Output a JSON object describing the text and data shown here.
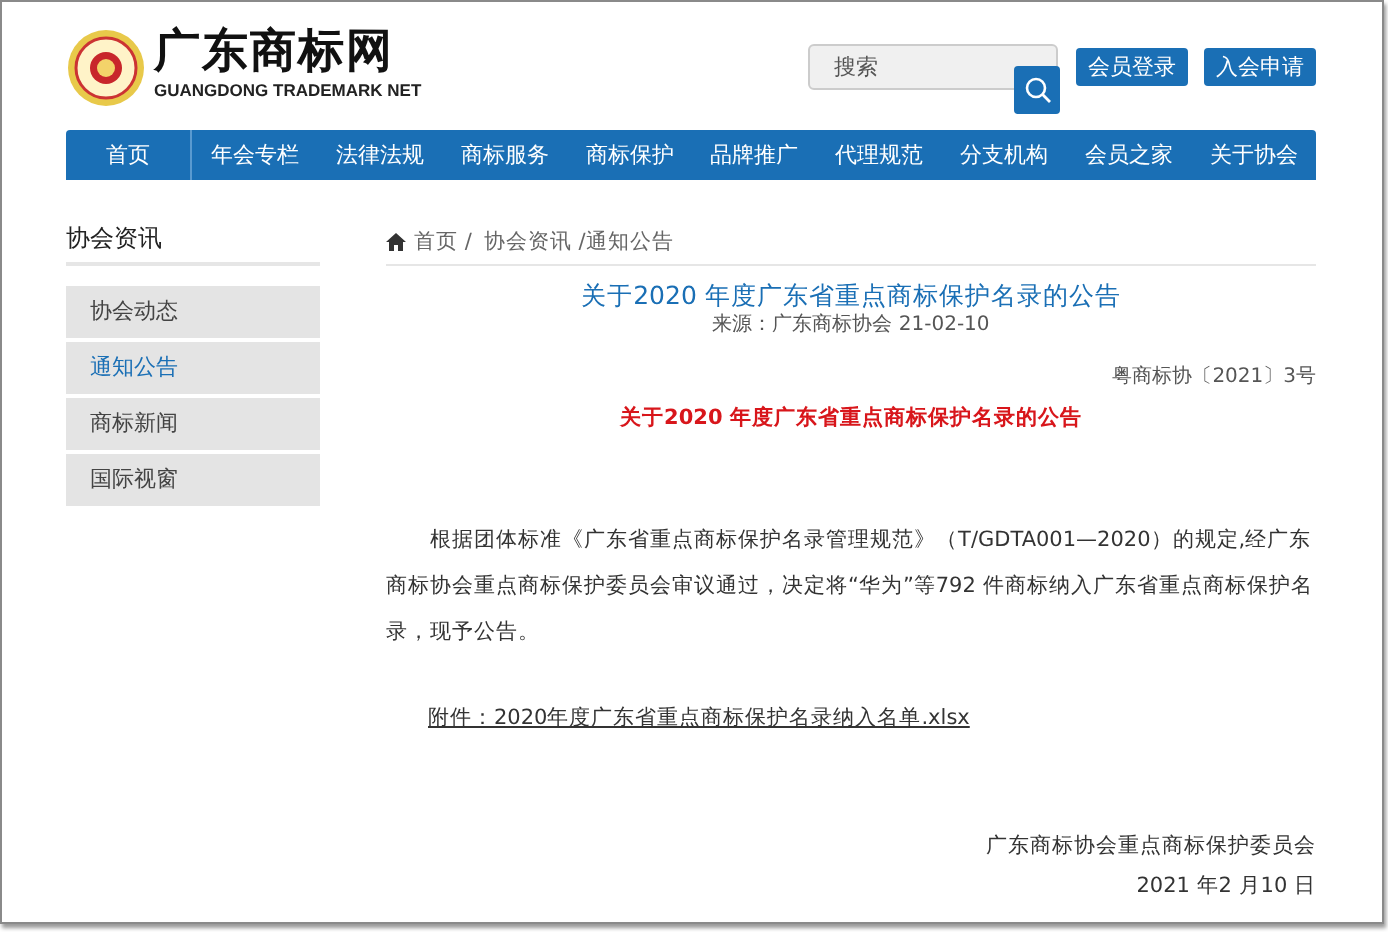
{
  "header": {
    "site_name": "广东商标网",
    "site_name_en": "GUANGDONG TRADEMARK NET",
    "search": {
      "placeholder": "搜索"
    },
    "buttons": [
      "会员登录",
      "入会申请"
    ]
  },
  "nav": [
    "首页",
    "年会专栏",
    "法律法规",
    "商标服务",
    "商标保护",
    "品牌推广",
    "代理规范",
    "分支机构",
    "会员之家",
    "关于协会"
  ],
  "sidebar": {
    "title": "协会资讯",
    "items": [
      {
        "label": "协会动态",
        "selected": false
      },
      {
        "label": "通知公告",
        "selected": true
      },
      {
        "label": "商标新闻",
        "selected": false
      },
      {
        "label": "国际视窗",
        "selected": false
      }
    ]
  },
  "breadcrumb": [
    "首页 /",
    "协会资讯 /通知公告"
  ],
  "article": {
    "title": "关于2020 年度广东省重点商标保护名录的公告",
    "source": "来源：广东商标协会 21-02-10",
    "doc_number": "粤商标协〔2021〕3号",
    "heading": "关于2020 年度广东省重点商标保护名录的公告",
    "body": "根据团体标准《广东省重点商标保护名录管理规范》（T/GDTA001—2020）的规定,经广东商标协会重点商标保护委员会审议通过，决定将“华为”等792 件商标纳入广东省重点商标保护名录，现予公告。",
    "attachment": "附件：2020年度广东省重点商标保护名录纳入名单.xlsx",
    "signature": "广东商标协会重点商标保护委员会",
    "date": "2021 年2 月10 日"
  }
}
